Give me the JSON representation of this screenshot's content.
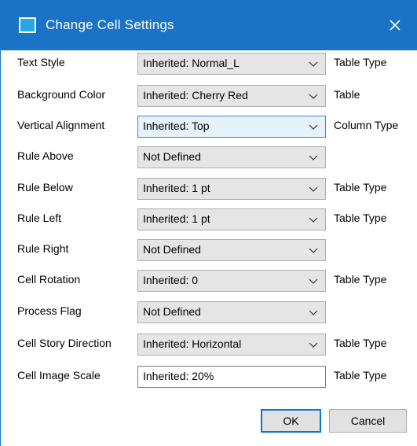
{
  "window": {
    "title": "Change Cell Settings",
    "close_glyph": "✕",
    "title_icon": "window-icon",
    "accent_color": "#1a73c6"
  },
  "fields": [
    {
      "label": "Text Style",
      "value": "Inherited: Normal_L",
      "source": "Table Type",
      "control": "dropdown"
    },
    {
      "label": "Background Color",
      "value": "Inherited: Cherry Red",
      "source": "Table",
      "control": "dropdown"
    },
    {
      "label": "Vertical Alignment",
      "value": "Inherited: Top",
      "source": "Column Type",
      "control": "dropdown",
      "focused": true
    },
    {
      "label": "Rule Above",
      "value": "Not Defined",
      "source": "",
      "control": "dropdown"
    },
    {
      "label": "Rule Below",
      "value": "Inherited: 1 pt",
      "source": "Table Type",
      "control": "dropdown"
    },
    {
      "label": "Rule Left",
      "value": "Inherited: 1 pt",
      "source": "Table Type",
      "control": "dropdown"
    },
    {
      "label": "Rule Right",
      "value": "Not Defined",
      "source": "",
      "control": "dropdown"
    },
    {
      "label": "Cell Rotation",
      "value": "Inherited: 0",
      "source": "Table Type",
      "control": "dropdown"
    },
    {
      "label": "Process Flag",
      "value": "Not Defined",
      "source": "",
      "control": "dropdown"
    },
    {
      "label": "Cell Story Direction",
      "value": "Inherited: Horizontal",
      "source": "Table Type",
      "control": "dropdown"
    },
    {
      "label": "Cell Image Scale",
      "value": "Inherited: 20%",
      "source": "Table Type",
      "control": "text"
    }
  ],
  "buttons": {
    "ok": "OK",
    "cancel": "Cancel"
  }
}
